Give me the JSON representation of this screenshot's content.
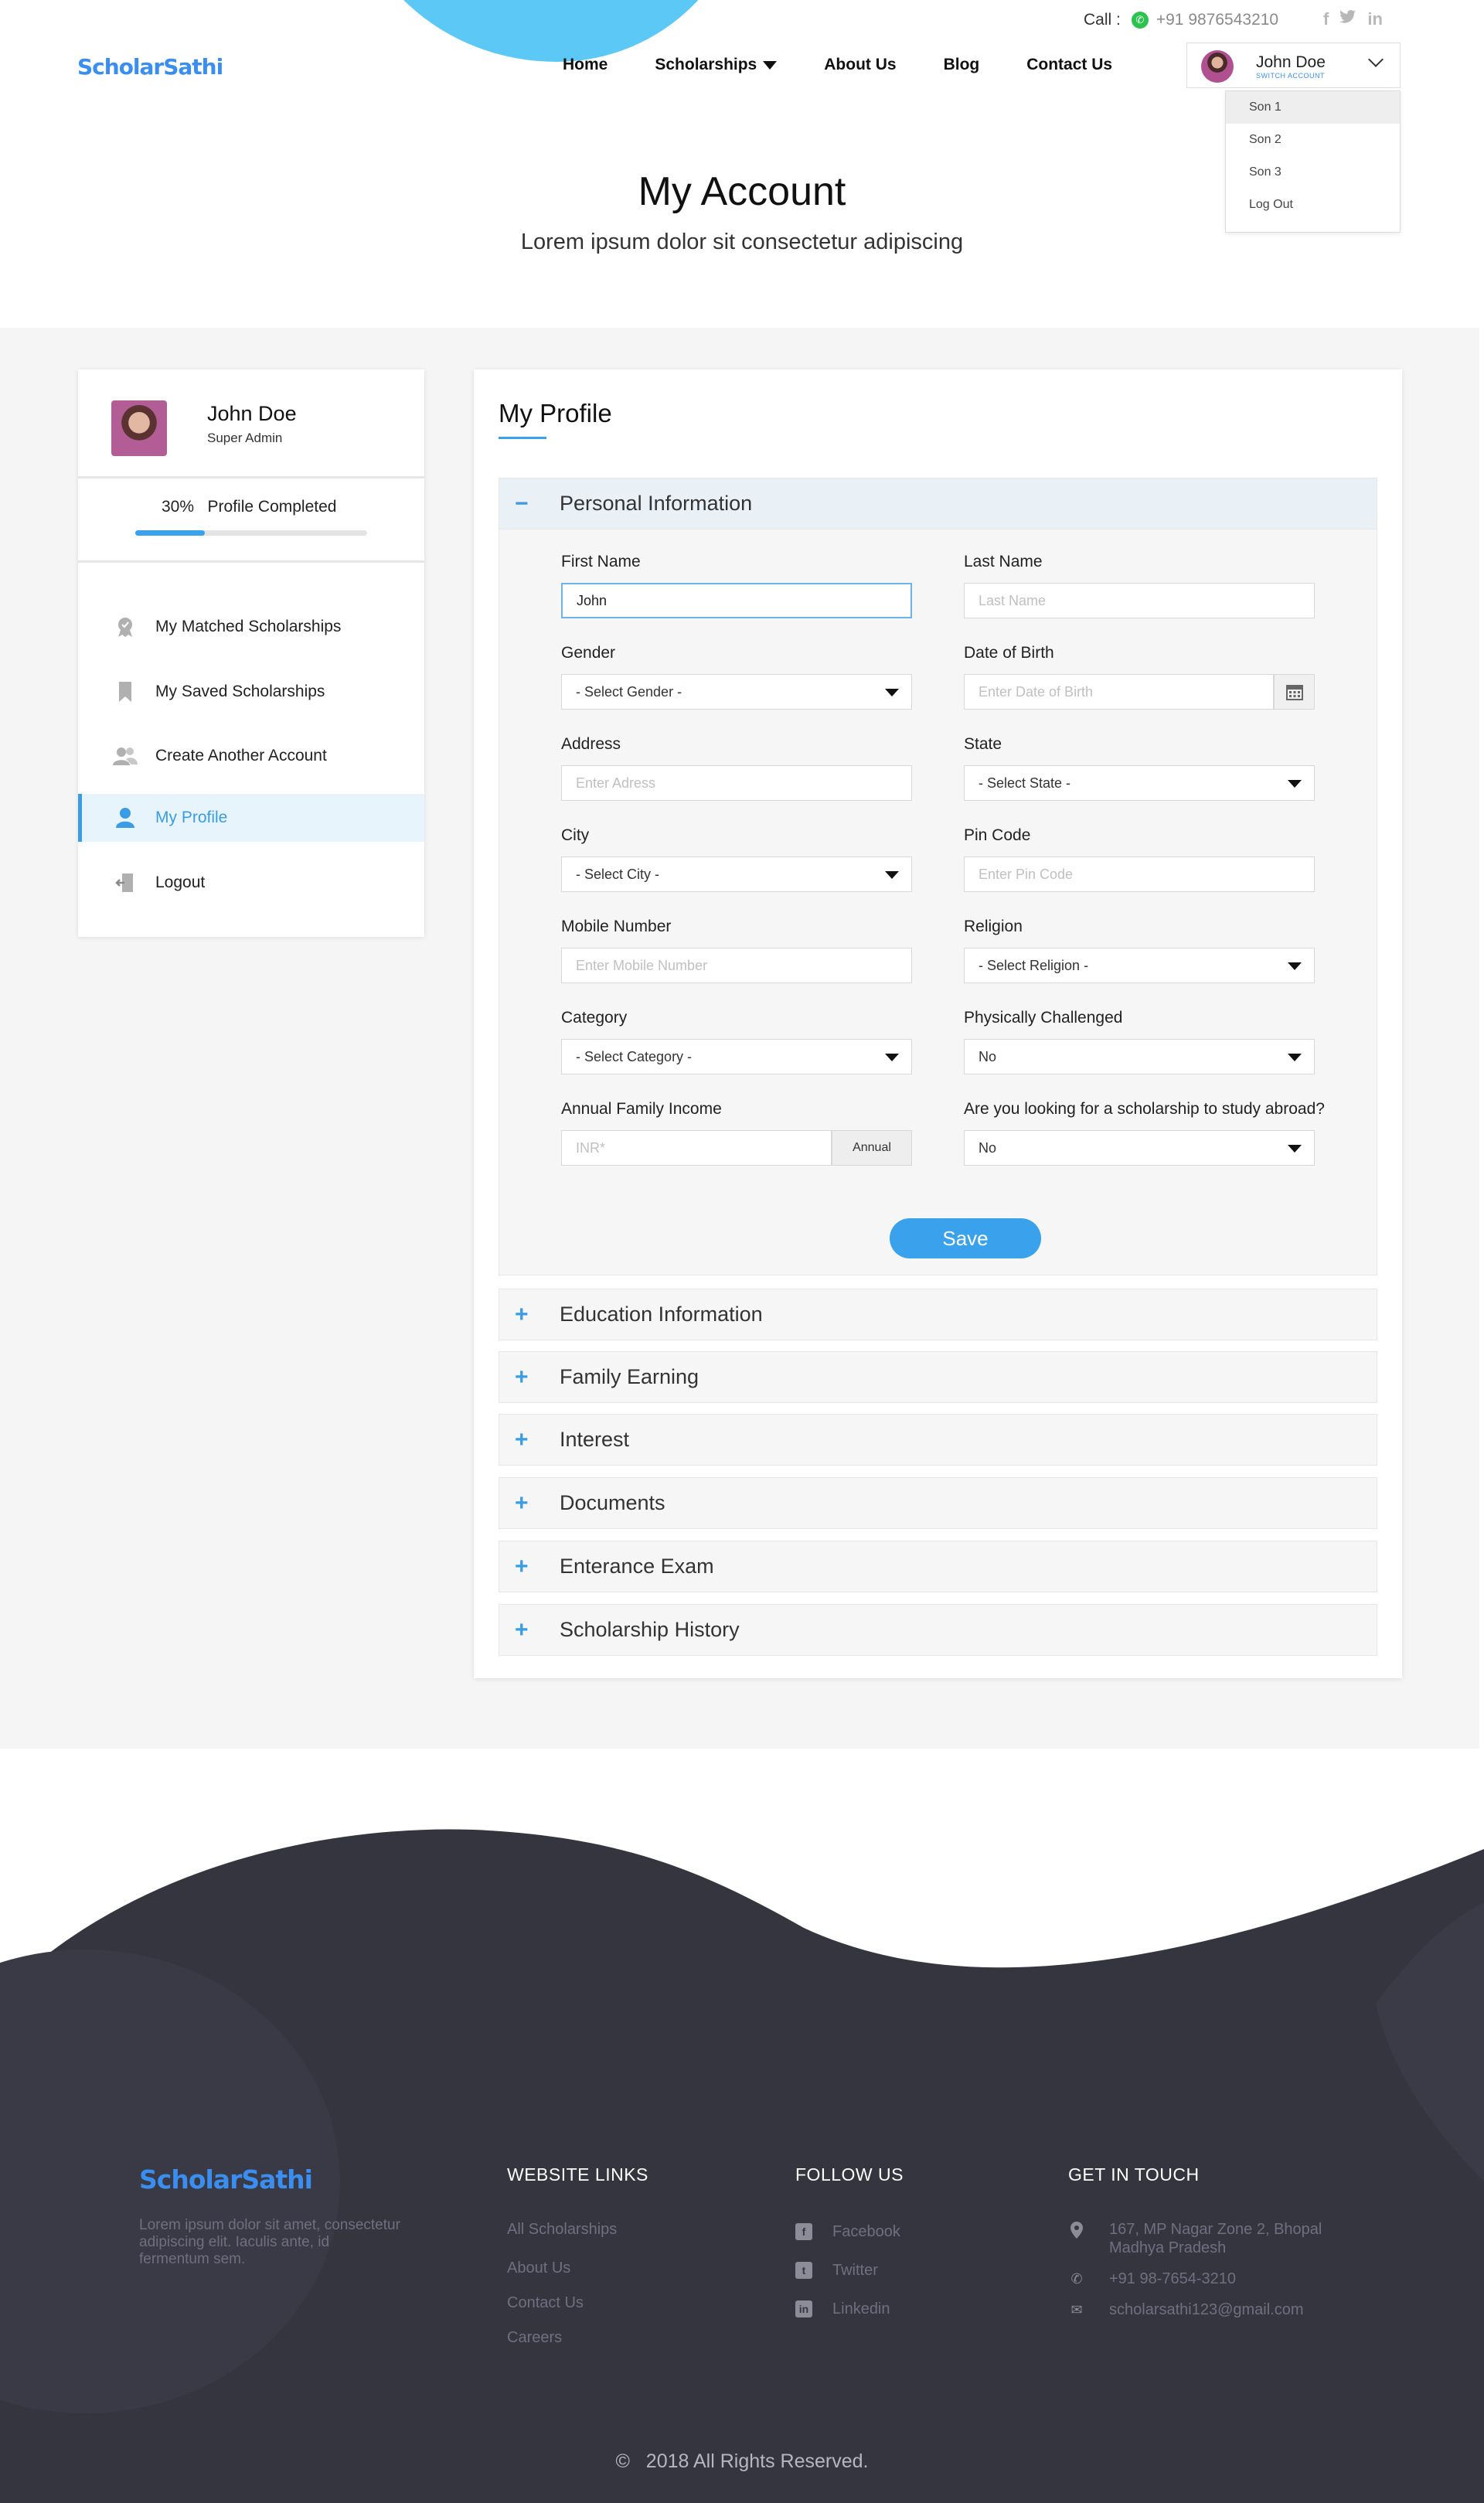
{
  "header": {
    "logo": "ScholarSathi",
    "call_label": "Call :",
    "phone": "+91 9876543210",
    "social": [
      "f",
      "t",
      "in"
    ],
    "nav": [
      "Home",
      "Scholarships",
      "About Us",
      "Blog",
      "Contact Us"
    ],
    "user": {
      "name": "John Doe",
      "switch_label": "SWITCH ACCOUNT"
    },
    "dropdown": [
      "Son 1",
      "Son 2",
      "Son 3",
      "Log Out"
    ]
  },
  "page": {
    "title": "My Account",
    "subtitle": "Lorem ipsum dolor sit consectetur adipiscing"
  },
  "sidebar": {
    "name": "John Doe",
    "role": "Super Admin",
    "progress_percent": "30%",
    "progress_label": "Profile Completed",
    "progress_value": 0.3,
    "items": [
      {
        "label": "My Matched Scholarships",
        "icon": "badge-icon"
      },
      {
        "label": "My Saved Scholarships",
        "icon": "bookmark-icon"
      },
      {
        "label": "Create Another Account",
        "icon": "users-icon"
      },
      {
        "label": "My Profile",
        "icon": "user-icon"
      },
      {
        "label": "Logout",
        "icon": "logout-icon"
      }
    ]
  },
  "profile": {
    "title": "My Profile",
    "personal": {
      "heading": "Personal Information",
      "toggle": "−",
      "first_name": {
        "label": "First Name",
        "value": "John"
      },
      "last_name": {
        "label": "Last Name",
        "placeholder": "Last Name"
      },
      "gender": {
        "label": "Gender",
        "value": "- Select Gender -"
      },
      "dob": {
        "label": "Date of Birth",
        "placeholder": "Enter Date of Birth"
      },
      "address": {
        "label": "Address",
        "placeholder": "Enter Adress"
      },
      "state": {
        "label": "State",
        "value": "- Select State -"
      },
      "city": {
        "label": "City",
        "value": "- Select City -"
      },
      "pincode": {
        "label": "Pin Code",
        "placeholder": "Enter Pin Code"
      },
      "mobile": {
        "label": "Mobile Number",
        "placeholder": "Enter Mobile Number"
      },
      "religion": {
        "label": "Religion",
        "value": "- Select Religion -"
      },
      "category": {
        "label": "Category",
        "value": "- Select Category -"
      },
      "physically_challenged": {
        "label": "Physically Challenged",
        "value": "No"
      },
      "income": {
        "label": "Annual Family Income",
        "placeholder": "INR*",
        "addon": "Annual"
      },
      "abroad": {
        "label": "Are you looking for a scholarship to study abroad?",
        "value": "No"
      },
      "save": "Save"
    },
    "sections": [
      {
        "label": "Education Information",
        "toggle": "+"
      },
      {
        "label": "Family Earning",
        "toggle": "+"
      },
      {
        "label": "Interest",
        "toggle": "+"
      },
      {
        "label": "Documents",
        "toggle": "+"
      },
      {
        "label": "Enterance Exam",
        "toggle": "+"
      },
      {
        "label": "Scholarship History",
        "toggle": "+"
      }
    ]
  },
  "footer": {
    "logo": "ScholarSathi",
    "description": "Lorem ipsum dolor sit amet, consectetur adipiscing elit. Iaculis ante, id fermentum sem.",
    "links_heading": "WEBSITE LINKS",
    "links": [
      "All Scholarships",
      "About Us",
      "Contact Us",
      "Careers"
    ],
    "follow_heading": "FOLLOW US",
    "follow": [
      "Facebook",
      "Twitter",
      "Linkedin"
    ],
    "contact_heading": "GET IN TOUCH",
    "address": "167, MP Nagar Zone 2, Bhopal Madhya Pradesh",
    "phone": "+91 98-7654-3210",
    "email": "scholarsathi123@gmail.com",
    "copyright_symbol": "©",
    "copyright": "2018 All Rights Reserved."
  },
  "colors": {
    "accent": "#3a9de4",
    "logo": "#3a8ef0",
    "footer_bg": "#34353f",
    "blob": "#5cc8f5"
  }
}
